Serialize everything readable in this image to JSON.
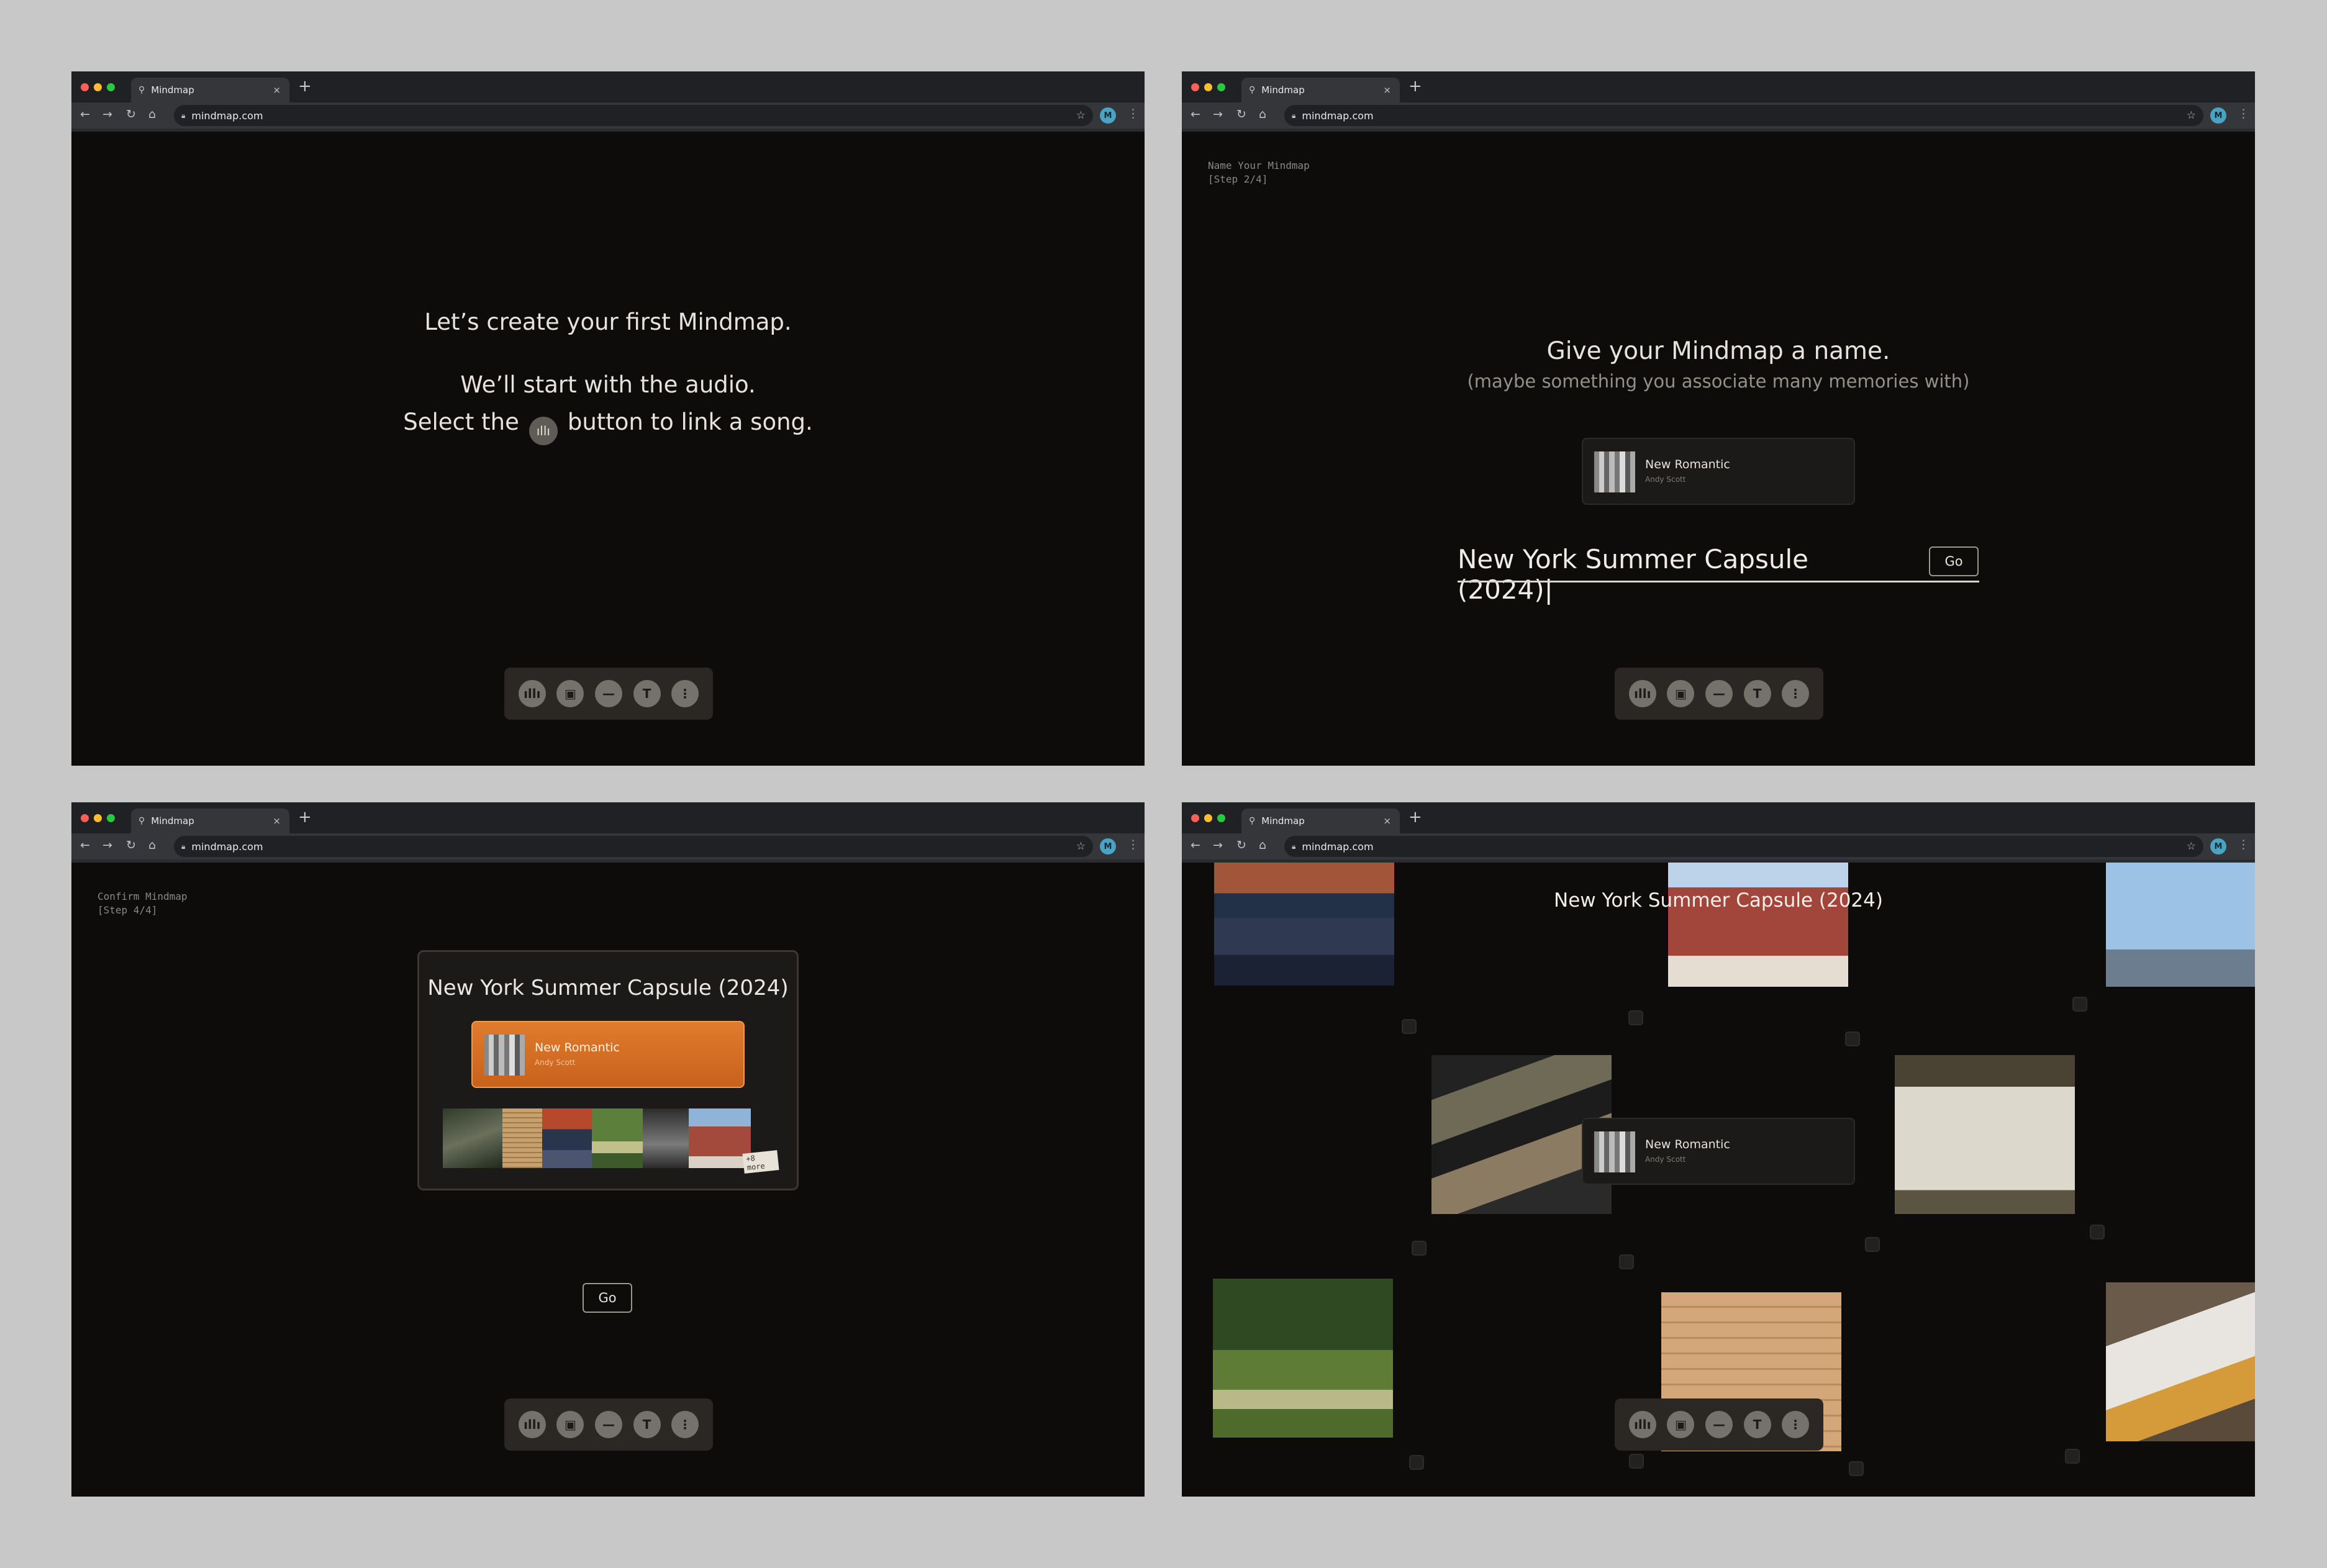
{
  "browser": {
    "tab_title": "Mindmap",
    "tab_close": "×",
    "new_tab": "+",
    "url": "mindmap.com",
    "avatar": "M"
  },
  "toolbar": {
    "items": [
      {
        "icon": "audio-waveform-icon",
        "glyph": "ıllı"
      },
      {
        "icon": "image-icon",
        "glyph": "▣"
      },
      {
        "icon": "divider-line-icon",
        "glyph": "—"
      },
      {
        "icon": "text-icon",
        "glyph": "T"
      },
      {
        "icon": "more-vertical-icon",
        "glyph": "⋮"
      }
    ]
  },
  "song": {
    "title": "New Romantic",
    "artist": "Andy Scott"
  },
  "screen1": {
    "line1": "Let’s create your first Mindmap.",
    "line2": "We’ll start with the audio.",
    "line3_before": "Select the",
    "line3_after": "button to link a song."
  },
  "screen2": {
    "step_title": "Name Your Mindmap",
    "step_count": "[Step 2/4]",
    "heading": "Give your Mindmap a name.",
    "subheading": "(maybe something you associate many memories with)",
    "input_value": "New York Summer Capsule (2024)|",
    "go_label": "Go"
  },
  "screen3": {
    "step_title": "Confirm Mindmap",
    "step_count": "[Step 4/4]",
    "card_title": "New York Summer Capsule (2024)",
    "more_label": "+8 more",
    "go_label": "Go"
  },
  "screen4": {
    "title": "New York Summer Capsule (2024)"
  },
  "colors": {
    "background": "#0e0c0b",
    "accent_orange": "#e07a2c",
    "chrome": "#202124"
  }
}
